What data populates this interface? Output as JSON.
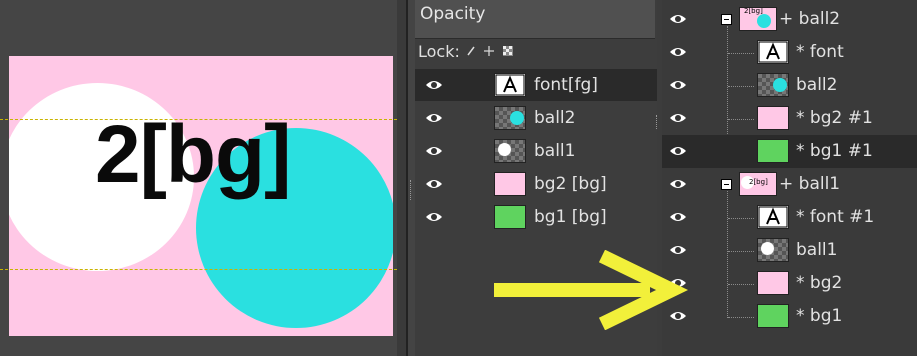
{
  "canvas": {
    "text": "2[bg]",
    "colors": {
      "background": "#ffc8e6",
      "ball1": "#ffffff",
      "ball2": "#2ae0e0",
      "text": "#0a0a0a",
      "guide": "#c8b400"
    }
  },
  "mid_panel": {
    "opacity_label": "Opacity",
    "lock_label": "Lock:",
    "layers": [
      {
        "label": "font[fg]",
        "thumb": "font",
        "selected": true
      },
      {
        "label": "ball2",
        "thumb": "ball2"
      },
      {
        "label": "ball1",
        "thumb": "ball1"
      },
      {
        "label": "bg2 [bg]",
        "thumb": "pink"
      },
      {
        "label": "bg1 [bg]",
        "thumb": "green"
      }
    ]
  },
  "right_panel": {
    "layers": [
      {
        "label": "+ ball2",
        "thumb_text": "2[bg]",
        "group": true
      },
      {
        "label": "* font",
        "thumb": "font"
      },
      {
        "label": "ball2",
        "thumb": "ball2"
      },
      {
        "label": "* bg2 #1",
        "thumb": "pink"
      },
      {
        "label": "* bg1 #1",
        "thumb": "green",
        "selected": true
      },
      {
        "label": "+ ball1",
        "thumb_text": "2[bg]",
        "group": true
      },
      {
        "label": "* font #1",
        "thumb": "font"
      },
      {
        "label": "ball1",
        "thumb": "ball1"
      },
      {
        "label": "* bg2",
        "thumb": "pink"
      },
      {
        "label": "* bg1",
        "thumb": "green"
      }
    ]
  },
  "colors": {
    "pink": "#ffc8e6",
    "green": "#5fd35f",
    "cyan": "#2ae0e0",
    "arrow": "#f2f03a"
  },
  "icons": [
    "eye-icon",
    "font-layer-icon",
    "lock-pixels-icon",
    "lock-position-icon",
    "lock-alpha-icon",
    "collapse-icon",
    "arrow-icon"
  ]
}
